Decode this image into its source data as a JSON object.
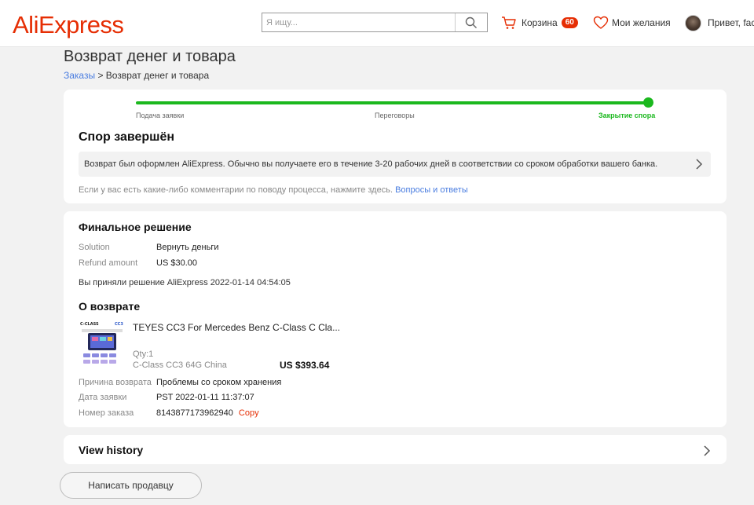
{
  "header": {
    "logo": "AliExpress",
    "search_placeholder": "Я ищу...",
    "cart_label": "Корзина",
    "cart_count": "60",
    "wishlist_label": "Мои желания",
    "greeting": "Привет, face"
  },
  "page": {
    "title": "Возврат денег и товара",
    "breadcrumb_link": "Заказы",
    "breadcrumb_sep": " > ",
    "breadcrumb_current": "Возврат денег и товара"
  },
  "progress": {
    "steps": [
      "Подача заявки",
      "Переговоры",
      "Закрытие спора"
    ],
    "status_title": "Спор завершён",
    "info_text": "Возврат был оформлен AliExpress. Обычно вы получаете его в течение 3-20 рабочих дней в соответствии со сроком обработки вашего банка.",
    "comment_text": "Если у вас есть какие-либо комментарии по поводу процесса, нажмите здесь.",
    "faq_link": "Вопросы и ответы"
  },
  "decision": {
    "title": "Финальное решение",
    "solution_label": "Solution",
    "solution_value": "Вернуть деньги",
    "refund_label": "Refund amount",
    "refund_value": "US $30.00",
    "accepted_text": "Вы приняли решение AliExpress 2022-01-14 04:54:05"
  },
  "refund_about": {
    "title": "О возврате",
    "product_name": "TEYES CC3 For Mercedes Benz C-Class C Cla...",
    "qty": "Qty:1",
    "variant": "C-Class CC3 64G China",
    "price": "US $393.64",
    "thumb_labels": [
      "C-CLASS",
      "CC3"
    ],
    "reason_label": "Причина возврата",
    "reason_value": "Проблемы со сроком хранения",
    "date_label": "Дата заявки",
    "date_value": "PST 2022-01-11 11:37:07",
    "order_label": "Номер заказа",
    "order_value": "8143877173962940",
    "copy_label": "Copy"
  },
  "history": {
    "title": "View history"
  },
  "actions": {
    "contact_seller": "Написать продавцу"
  },
  "colors": {
    "brand": "#e62e04",
    "progress": "#1bb81e",
    "link": "#4a7de0"
  }
}
